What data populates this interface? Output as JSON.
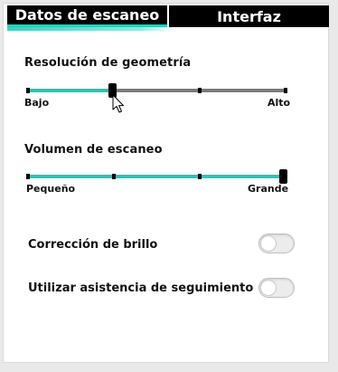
{
  "tabs": [
    {
      "label": "Datos de escaneo",
      "active": true
    },
    {
      "label": "Interfaz",
      "active": false
    }
  ],
  "sliders": {
    "geometry_resolution": {
      "title": "Resolución de geometría",
      "min_label": "Bajo",
      "max_label": "Alto",
      "value": 0.33,
      "steps": 4
    },
    "scan_volume": {
      "title": "Volumen de escaneo",
      "min_label": "Pequeño",
      "max_label": "Grande",
      "value": 1.0,
      "steps": 4
    }
  },
  "toggles": {
    "brightness_correction": {
      "label": "Corrección de brillo",
      "on": false
    },
    "tracking_assistance": {
      "label": "Utilizar asistencia de seguimiento",
      "on": false
    }
  },
  "colors": {
    "accent": "#1fc9b7",
    "track": "#7b7b7b",
    "tab_bg": "#000000"
  },
  "icons": {
    "cursor": "mouse-pointer-icon"
  }
}
